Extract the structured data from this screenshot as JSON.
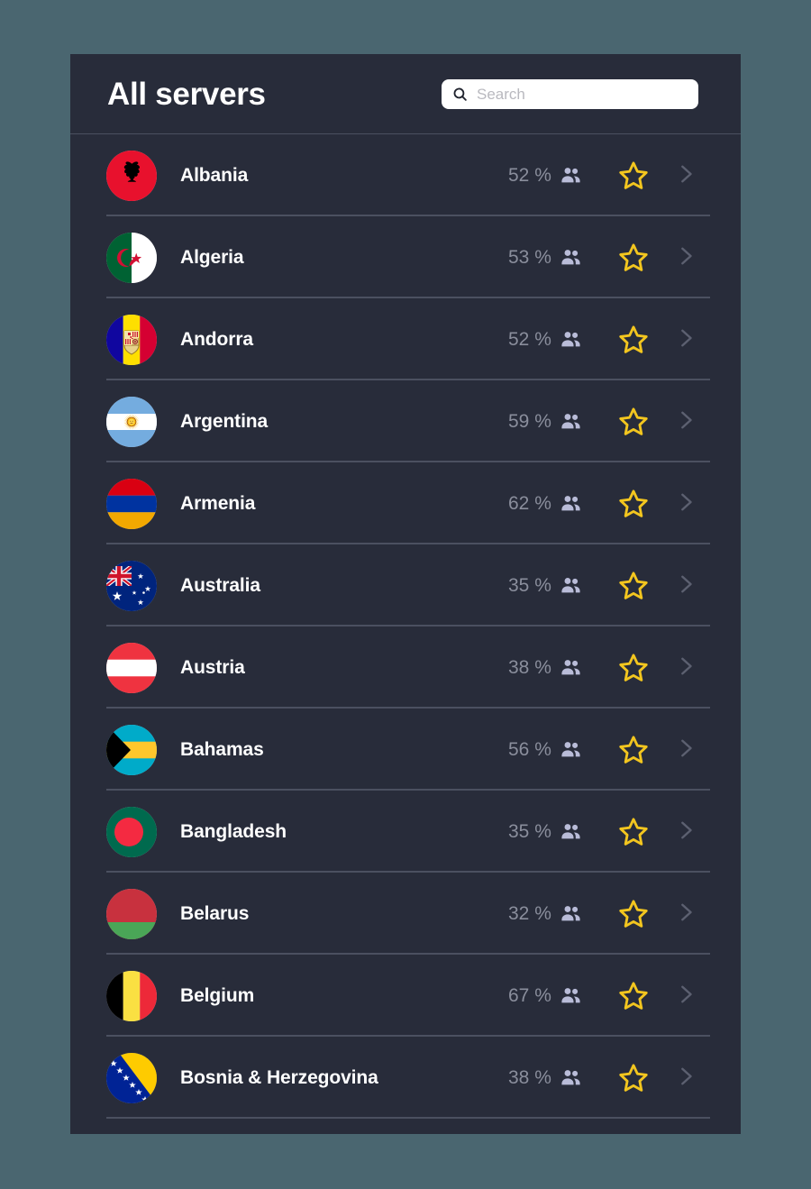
{
  "header": {
    "title": "All servers",
    "search": {
      "placeholder": "Search",
      "value": "",
      "icon": "search-icon"
    }
  },
  "colors": {
    "page_background": "#4a6670",
    "card_background": "#282c3a",
    "divider": "#4b5060",
    "title_text": "#ffffff",
    "name_text": "#ffffff",
    "percent_text": "#8a8e9c",
    "people_icon": "#b9bcd8",
    "star_icon": "#f3c61f",
    "chevron_icon": "#5c6070",
    "search_background": "#ffffff",
    "search_placeholder": "#b9b9bf"
  },
  "row_icons": {
    "people": "people-icon",
    "favorite": "star-outline-icon",
    "open": "chevron-right-icon"
  },
  "servers": [
    {
      "name": "Albania",
      "load": "52 %",
      "flag": "al",
      "favorite": false
    },
    {
      "name": "Algeria",
      "load": "53 %",
      "flag": "dz",
      "favorite": false
    },
    {
      "name": "Andorra",
      "load": "52 %",
      "flag": "ad",
      "favorite": false
    },
    {
      "name": "Argentina",
      "load": "59 %",
      "flag": "ar",
      "favorite": false
    },
    {
      "name": "Armenia",
      "load": "62 %",
      "flag": "am",
      "favorite": false
    },
    {
      "name": "Australia",
      "load": "35 %",
      "flag": "au",
      "favorite": false
    },
    {
      "name": "Austria",
      "load": "38 %",
      "flag": "at",
      "favorite": false
    },
    {
      "name": "Bahamas",
      "load": "56 %",
      "flag": "bs",
      "favorite": false
    },
    {
      "name": "Bangladesh",
      "load": "35 %",
      "flag": "bd",
      "favorite": false
    },
    {
      "name": "Belarus",
      "load": "32 %",
      "flag": "by",
      "favorite": false
    },
    {
      "name": "Belgium",
      "load": "67 %",
      "flag": "be",
      "favorite": false
    },
    {
      "name": "Bosnia & Herzegovina",
      "load": "38 %",
      "flag": "ba",
      "favorite": false
    }
  ]
}
